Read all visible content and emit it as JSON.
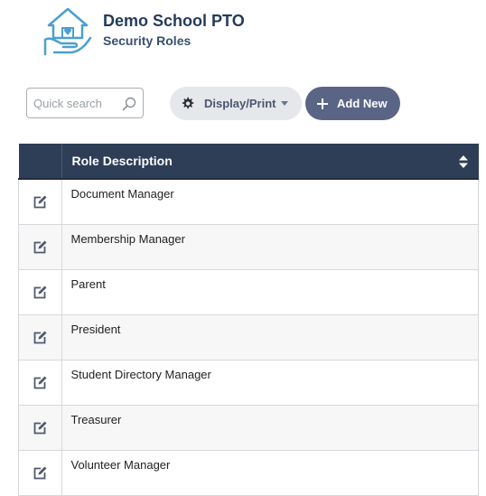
{
  "header": {
    "org_name": "Demo School PTO",
    "page_title": "Security Roles",
    "logo_icon": "house-in-hands-icon"
  },
  "toolbar": {
    "search_placeholder": "Quick search",
    "search_value": "",
    "display_print_label": "Display/Print",
    "add_new_label": "Add New"
  },
  "table": {
    "column_header": "Role Description",
    "rows": [
      {
        "description": "Document Manager"
      },
      {
        "description": "Membership Manager"
      },
      {
        "description": "Parent"
      },
      {
        "description": "President"
      },
      {
        "description": "Student Directory Manager"
      },
      {
        "description": "Treasurer"
      },
      {
        "description": "Volunteer Manager"
      }
    ]
  },
  "colors": {
    "header_bg": "#2e3e57",
    "add_button_bg": "#5a6586",
    "display_button_bg": "#e6e7ea",
    "title_text": "#243b5a"
  }
}
